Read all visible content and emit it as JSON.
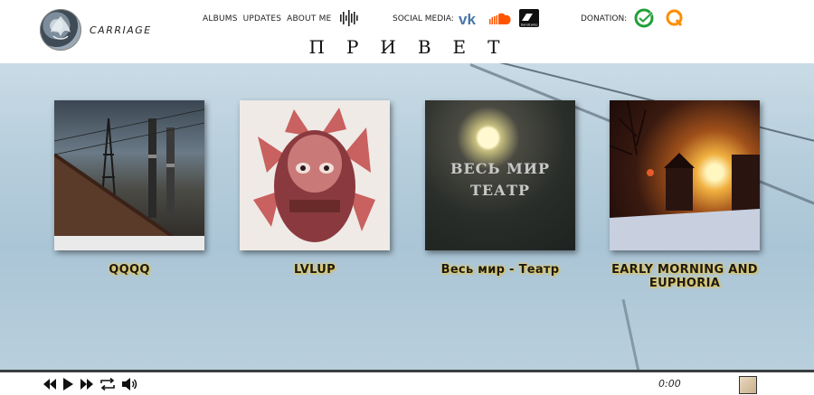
{
  "header": {
    "logo_text": "CARRIAGE",
    "nav": [
      "ALBUMS",
      "UPDATES",
      "ABOUT ME"
    ],
    "social_label": "SOCIAL MEDIA:",
    "donation_label": "DONATION:",
    "greeting": "ПРИВЕТ",
    "social_icons": [
      "vk-icon",
      "soundcloud-icon",
      "bandcamp-icon"
    ],
    "donation_icons": [
      "sberbank-icon",
      "qiwi-icon"
    ],
    "bandcamp_caption": "bandcamp"
  },
  "albums": [
    {
      "title": "QQQQ"
    },
    {
      "title": "LVLUP"
    },
    {
      "title": "Весь мир - Театр",
      "cover_text_line1": "ВЕСЬ МИР",
      "cover_text_line2": "ТЕАТР"
    },
    {
      "title": "EARLY MORNING AND EUPHORIA"
    }
  ],
  "player": {
    "time": "0:00",
    "controls": [
      "previous-icon",
      "play-icon",
      "next-icon",
      "repeat-icon",
      "volume-icon"
    ]
  },
  "colors": {
    "title_glow": "#f0d060",
    "player_border": "#3a3d40",
    "vk_blue": "#4a76a8",
    "soundcloud_orange": "#ff5500",
    "sber_green": "#21a038",
    "qiwi_orange": "#ff8c00"
  }
}
